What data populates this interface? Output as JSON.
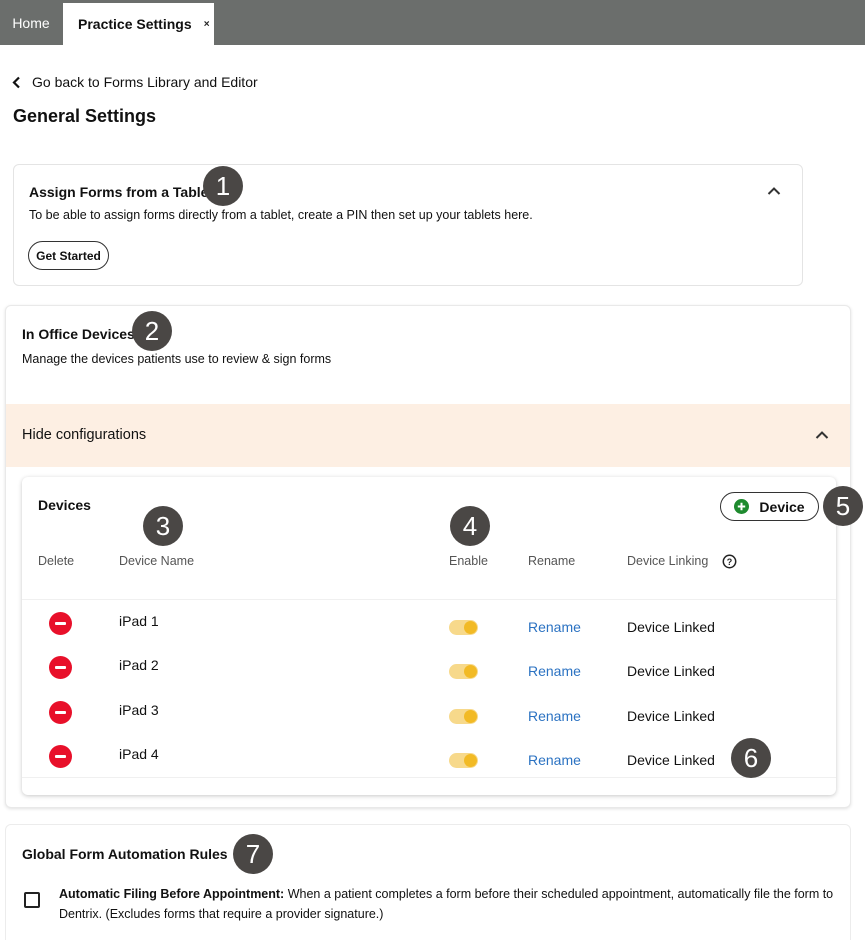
{
  "tabs": {
    "home": "Home",
    "active": "Practice Settings",
    "close_glyph": "×"
  },
  "back_link": "Go back to Forms Library and Editor",
  "page_title": "General Settings",
  "tablet_card": {
    "title": "Assign Forms from a Tablet",
    "description": "To be able to assign forms directly from a tablet, create a PIN then set up your tablets here.",
    "button": "Get Started"
  },
  "devices_card": {
    "title": "In Office Devices",
    "description": "Manage the devices patients use to review & sign forms",
    "config_toggle": "Hide configurations",
    "panel_title": "Devices",
    "add_button": "Device",
    "columns": {
      "delete": "Delete",
      "name": "Device Name",
      "enable": "Enable",
      "rename": "Rename",
      "linking": "Device Linking"
    },
    "rows": [
      {
        "name": "iPad 1",
        "enabled": true,
        "rename": "Rename",
        "status": "Device Linked"
      },
      {
        "name": "iPad 2",
        "enabled": true,
        "rename": "Rename",
        "status": "Device Linked"
      },
      {
        "name": "iPad 3",
        "enabled": true,
        "rename": "Rename",
        "status": "Device Linked"
      },
      {
        "name": "iPad 4",
        "enabled": true,
        "rename": "Rename",
        "status": "Device Linked"
      }
    ]
  },
  "rules_card": {
    "title": "Global Form Automation Rules",
    "rule_label": "Automatic Filing Before Appointment:",
    "rule_text": " When a patient completes a form before their scheduled appointment, automatically file the form to Dentrix. (Excludes forms that require a provider signature.)",
    "checked": false
  },
  "callouts": [
    "1",
    "2",
    "3",
    "4",
    "5",
    "6",
    "7"
  ],
  "colors": {
    "tabbar": "#6b6e6c",
    "config_bar": "#fdefe3",
    "delete_red": "#e8102a",
    "toggle_on": "#f2ba25",
    "link_blue": "#2b72c2",
    "add_green": "#1e8a2e",
    "callout_badge": "#4a4745"
  },
  "icons": [
    "close-icon",
    "chevron-left-icon",
    "chevron-up-icon",
    "plus-circle-icon",
    "help-circle-icon",
    "delete-icon",
    "toggle-switch"
  ]
}
